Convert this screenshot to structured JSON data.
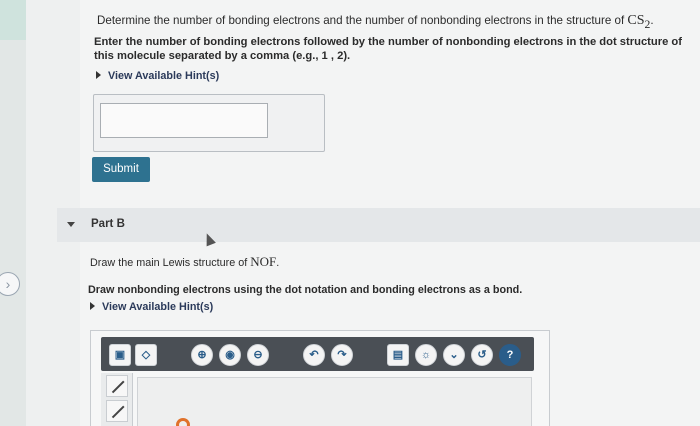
{
  "part_a": {
    "question_prefix": "Determine the number of bonding electrons and the number of nonbonding electrons in the structure of ",
    "molecule": "CS",
    "molecule_subscript": "2",
    "question_suffix": ".",
    "instruction": "Enter the number of bonding electrons followed by the number of nonbonding electrons in the dot structure of this molecule separated by a comma (e.g., 1 , 2).",
    "hint_label": "View Available Hint(s)",
    "answer_value": "",
    "submit_label": "Submit"
  },
  "part_b": {
    "label": "Part B",
    "question_prefix": "Draw the main Lewis structure of ",
    "molecule": "NOF",
    "question_suffix": ".",
    "instruction": "Draw nonbonding electrons using the dot notation and bonding electrons as a bond.",
    "hint_label": "View Available Hint(s)"
  },
  "toolbar": {
    "buttons": [
      {
        "icon": "select-icon"
      },
      {
        "icon": "eraser-icon"
      },
      {
        "icon": "zoom-in-icon"
      },
      {
        "icon": "zoom-reset-icon"
      },
      {
        "icon": "zoom-out-icon"
      },
      {
        "icon": "undo-icon"
      },
      {
        "icon": "redo-icon"
      },
      {
        "icon": "template-icon"
      },
      {
        "icon": "lightbulb-icon"
      },
      {
        "icon": "chevron-down-icon"
      },
      {
        "icon": "reset-icon"
      },
      {
        "icon": "help-icon",
        "glyph": "?"
      }
    ]
  },
  "side_tools": [
    {
      "icon": "single-bond-icon"
    },
    {
      "icon": "double-bond-icon"
    }
  ],
  "colors": {
    "submit_bg": "#2e7290",
    "toolbar_bg": "#4a4f55",
    "icon_blue": "#2a5d8a",
    "accent_orange": "#e0722b"
  }
}
